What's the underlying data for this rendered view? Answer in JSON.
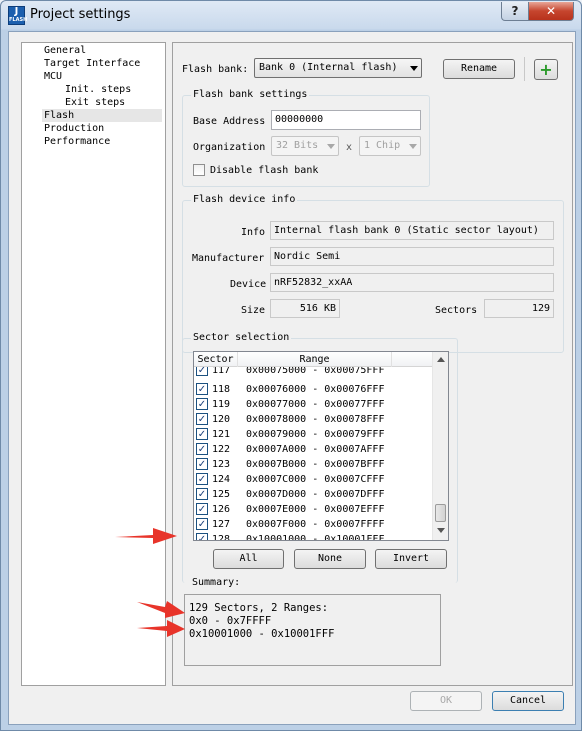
{
  "window": {
    "title": "Project settings",
    "icon_text_top": "J",
    "icon_text_bottom": "FLASH",
    "help_label": "?",
    "close_label": "✕"
  },
  "tree": {
    "items": [
      {
        "label": "General"
      },
      {
        "label": "Target Interface"
      },
      {
        "label": "MCU"
      },
      {
        "label": "Init. steps"
      },
      {
        "label": "Exit steps"
      },
      {
        "label": "Flash"
      },
      {
        "label": "Production"
      },
      {
        "label": "Performance"
      }
    ]
  },
  "flash_bank": {
    "label": "Flash bank:",
    "selected": "Bank 0 (Internal flash)",
    "rename_label": "Rename",
    "add_label": "+"
  },
  "bank_settings": {
    "title": "Flash bank settings",
    "base_address_label": "Base Address",
    "base_address_value": "00000000",
    "organization_label": "Organization",
    "bits_value": "32 Bits",
    "x_label": "x",
    "chip_value": "1 Chip",
    "disable_label": "Disable flash bank"
  },
  "device_info": {
    "title": "Flash device info",
    "info_label": "Info",
    "info_value": "Internal flash bank 0 (Static sector layout)",
    "manufacturer_label": "Manufacturer",
    "manufacturer_value": "Nordic Semi",
    "device_label": "Device",
    "device_value": "nRF52832_xxAA",
    "size_label": "Size",
    "size_value": "516 KB",
    "sectors_label": "Sectors",
    "sectors_value": "129"
  },
  "sector_selection": {
    "title": "Sector selection",
    "col_sector": "Sector",
    "col_range": "Range",
    "partial_row": {
      "sector": "117",
      "range": "0x00075000 - 0x00075FFF"
    },
    "rows": [
      {
        "sector": "118",
        "range": "0x00076000 - 0x00076FFF",
        "checked": true
      },
      {
        "sector": "119",
        "range": "0x00077000 - 0x00077FFF",
        "checked": true
      },
      {
        "sector": "120",
        "range": "0x00078000 - 0x00078FFF",
        "checked": true
      },
      {
        "sector": "121",
        "range": "0x00079000 - 0x00079FFF",
        "checked": true
      },
      {
        "sector": "122",
        "range": "0x0007A000 - 0x0007AFFF",
        "checked": true
      },
      {
        "sector": "123",
        "range": "0x0007B000 - 0x0007BFFF",
        "checked": true
      },
      {
        "sector": "124",
        "range": "0x0007C000 - 0x0007CFFF",
        "checked": true
      },
      {
        "sector": "125",
        "range": "0x0007D000 - 0x0007DFFF",
        "checked": true
      },
      {
        "sector": "126",
        "range": "0x0007E000 - 0x0007EFFF",
        "checked": true
      },
      {
        "sector": "127",
        "range": "0x0007F000 - 0x0007FFFF",
        "checked": true
      },
      {
        "sector": "128",
        "range": "0x10001000 - 0x10001FFF",
        "checked": true
      }
    ],
    "all_label": "All",
    "none_label": "None",
    "invert_label": "Invert"
  },
  "summary": {
    "label": "Summary:",
    "line1": "129 Sectors, 2 Ranges:",
    "line2": "0x0 - 0x7FFFF",
    "line3": "0x10001000 - 0x10001FFF"
  },
  "footer": {
    "ok_label": "OK",
    "cancel_label": "Cancel"
  },
  "colors": {
    "annotation_arrow": "#e8342a",
    "add_icon": "#2a9a2a"
  }
}
